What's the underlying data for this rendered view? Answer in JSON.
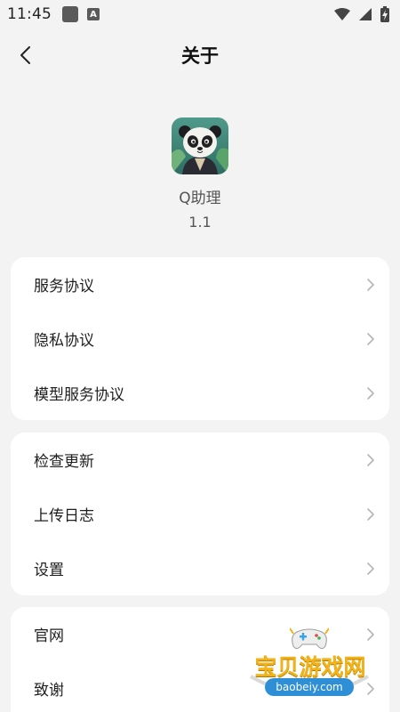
{
  "status_bar": {
    "time": "11:45",
    "notification_icon_letter": "A"
  },
  "header": {
    "title": "关于"
  },
  "app": {
    "name": "Q助理",
    "version": "1.1"
  },
  "sections": [
    {
      "items": [
        {
          "label": "服务协议"
        },
        {
          "label": "隐私协议"
        },
        {
          "label": "模型服务协议"
        }
      ]
    },
    {
      "items": [
        {
          "label": "检查更新"
        },
        {
          "label": "上传日志"
        },
        {
          "label": "设置"
        }
      ]
    },
    {
      "items": [
        {
          "label": "官网"
        },
        {
          "label": "致谢"
        }
      ]
    }
  ],
  "watermark": {
    "text": "宝贝游戏网",
    "url": "baobeiy.com"
  },
  "icons": {
    "back": "chevron-left-icon",
    "row_arrow": "chevron-right-icon"
  },
  "colors": {
    "background": "#f3f3f3",
    "card": "#ffffff",
    "chevron": "#b5b5b5",
    "watermark_text": "#f2b318",
    "watermark_url_bg": "#2e8fd6"
  }
}
